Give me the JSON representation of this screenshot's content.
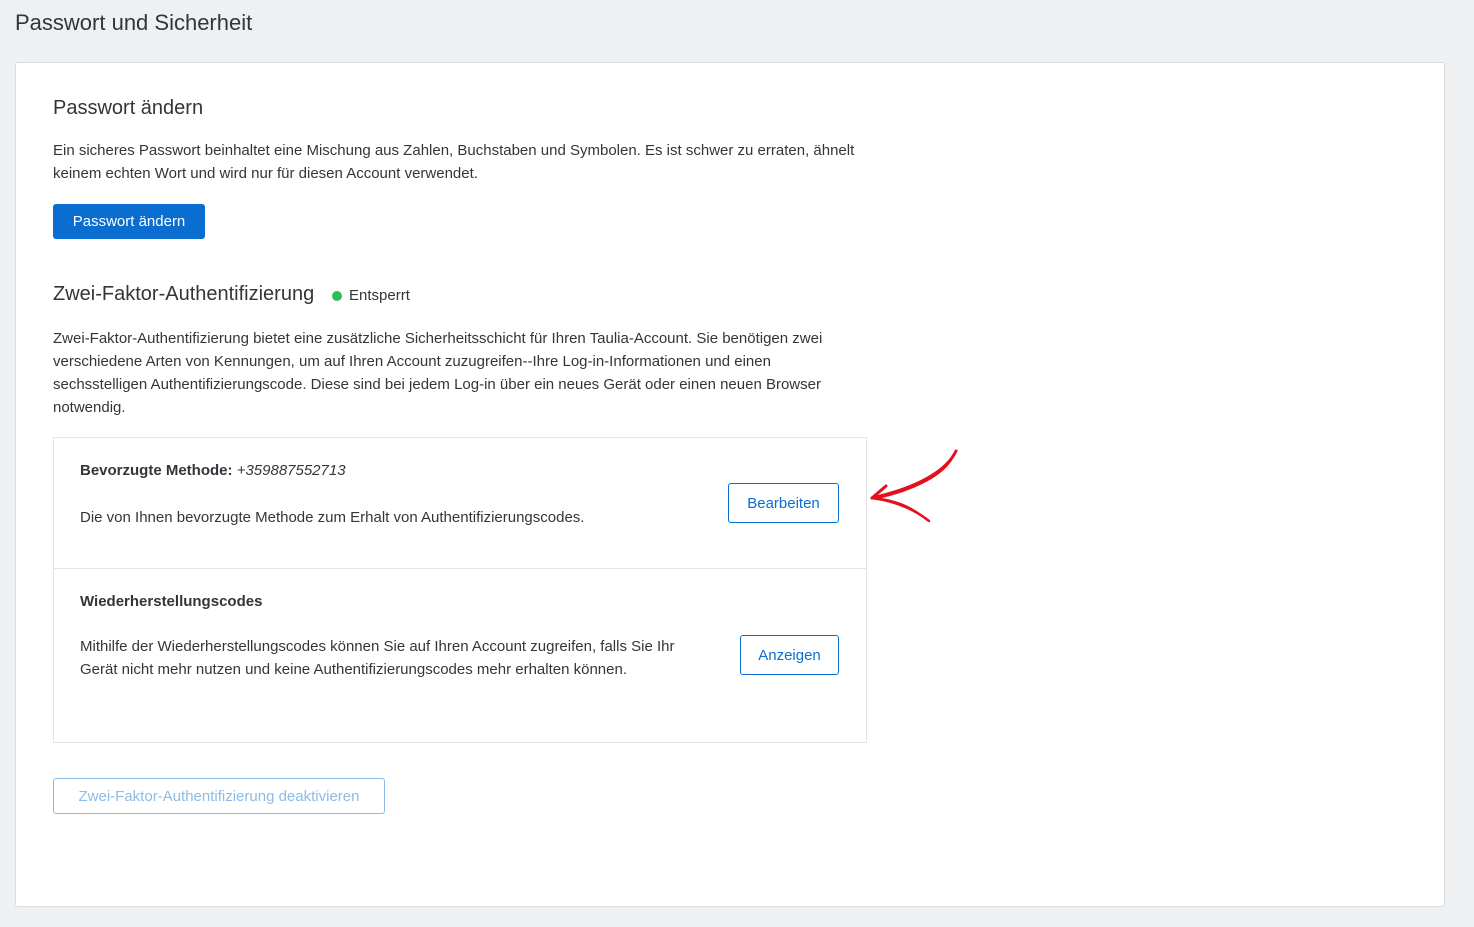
{
  "page": {
    "title": "Passwort und Sicherheit"
  },
  "password": {
    "heading": "Passwort ändern",
    "description": "Ein sicheres Passwort beinhaltet eine Mischung aus Zahlen, Buchstaben und Symbolen. Es ist schwer zu erraten, ähnelt keinem echten Wort und wird nur für diesen Account verwendet.",
    "button_label": "Passwort ändern"
  },
  "two_factor": {
    "heading": "Zwei-Faktor-Authentifizierung",
    "status_label": "Entsperrt",
    "status_color": "#2ebd59",
    "description": "Zwei-Faktor-Authentifizierung bietet eine zusätzliche Sicherheitsschicht für Ihren Taulia-Account. Sie benötigen zwei verschiedene Arten von Kennungen, um auf Ihren Account zuzugreifen--Ihre Log-in-Informationen und einen sechsstelligen Authentifizierungscode. Diese sind bei jedem Log-in über ein neues Gerät oder einen neuen Browser notwendig.",
    "preferred_method": {
      "label": "Bevorzugte Methode:",
      "value": "+359887552713",
      "description": "Die von Ihnen bevorzugte Methode zum Erhalt von Authentifizierungscodes.",
      "button_label": "Bearbeiten"
    },
    "recovery_codes": {
      "label": "Wiederherstellungscodes",
      "description": "Mithilfe der Wiederherstellungscodes können Sie auf Ihren Account zugreifen, falls Sie Ihr Gerät nicht mehr nutzen und keine Authentifizierungscodes mehr erhalten können.",
      "button_label": "Anzeigen"
    },
    "deactivate_label": "Zwei-Faktor-Authentifizierung deaktivieren"
  },
  "colors": {
    "accent": "#0a6ed1",
    "annotation_arrow": "#e3101e"
  },
  "icons": {
    "annotation": "red-arrow-icon"
  }
}
